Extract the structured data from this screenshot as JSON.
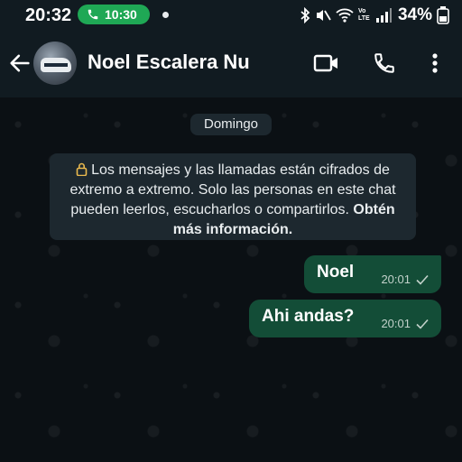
{
  "status_bar": {
    "time": "20:32",
    "call_timer": "10:30",
    "battery": "34%",
    "network_label": "Vo LTE",
    "call_pill_color": "#1fa855"
  },
  "header": {
    "contact_name": "Noel Escalera Nu",
    "icons": [
      "back-arrow-icon",
      "avatar",
      "video-call-icon",
      "voice-call-icon",
      "more-options-icon"
    ]
  },
  "chat": {
    "date_label": "Domingo",
    "encryption_notice": "Los mensajes y las llamadas están cifrados de extremo a extremo. Solo las personas en este chat pueden leerlos, escucharlos o compartirlos.",
    "encryption_more": "Obtén más información.",
    "messages": [
      {
        "text": "Noel",
        "time": "20:01",
        "status": "sent"
      },
      {
        "text": "Ahi andas?",
        "time": "20:01",
        "status": "sent"
      }
    ]
  },
  "colors": {
    "header_bg": "#111b21",
    "chat_bg": "#0b1014",
    "outgoing_bubble": "#134d37",
    "system_chip": "#1d282f"
  }
}
